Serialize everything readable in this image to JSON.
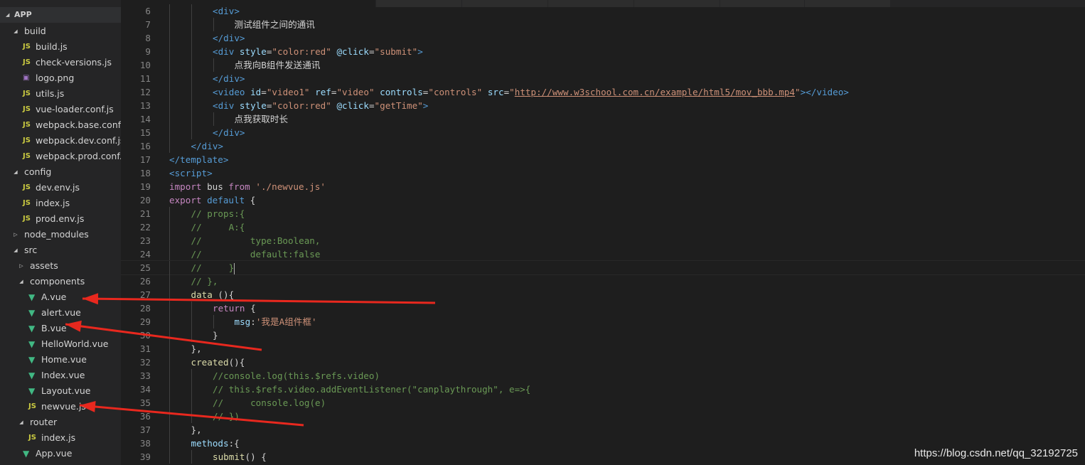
{
  "explorer": {
    "title": "APP",
    "items": [
      {
        "label": "build",
        "type": "folder",
        "expanded": true,
        "depth": 0,
        "icon": "chevron-down-icon"
      },
      {
        "label": "build.js",
        "type": "js",
        "depth": 1,
        "icon": "js-file-icon"
      },
      {
        "label": "check-versions.js",
        "type": "js",
        "depth": 1,
        "icon": "js-file-icon"
      },
      {
        "label": "logo.png",
        "type": "png",
        "depth": 1,
        "icon": "image-file-icon"
      },
      {
        "label": "utils.js",
        "type": "js",
        "depth": 1,
        "icon": "js-file-icon"
      },
      {
        "label": "vue-loader.conf.js",
        "type": "js",
        "depth": 1,
        "icon": "js-file-icon"
      },
      {
        "label": "webpack.base.conf.js",
        "type": "js",
        "depth": 1,
        "icon": "js-file-icon"
      },
      {
        "label": "webpack.dev.conf.js",
        "type": "js",
        "depth": 1,
        "icon": "js-file-icon"
      },
      {
        "label": "webpack.prod.conf.js",
        "type": "js",
        "depth": 1,
        "icon": "js-file-icon"
      },
      {
        "label": "config",
        "type": "folder",
        "expanded": true,
        "depth": 0,
        "icon": "chevron-down-icon"
      },
      {
        "label": "dev.env.js",
        "type": "js",
        "depth": 1,
        "icon": "js-file-icon"
      },
      {
        "label": "index.js",
        "type": "js",
        "depth": 1,
        "icon": "js-file-icon"
      },
      {
        "label": "prod.env.js",
        "type": "js",
        "depth": 1,
        "icon": "js-file-icon"
      },
      {
        "label": "node_modules",
        "type": "folder",
        "expanded": false,
        "depth": 0,
        "icon": "chevron-right-icon"
      },
      {
        "label": "src",
        "type": "folder",
        "expanded": true,
        "depth": 0,
        "icon": "chevron-down-icon"
      },
      {
        "label": "assets",
        "type": "folder",
        "expanded": false,
        "depth": 1,
        "icon": "chevron-right-icon"
      },
      {
        "label": "components",
        "type": "folder",
        "expanded": true,
        "depth": 1,
        "icon": "chevron-down-icon"
      },
      {
        "label": "A.vue",
        "type": "vue",
        "depth": 2,
        "icon": "vue-file-icon"
      },
      {
        "label": "alert.vue",
        "type": "vue",
        "depth": 2,
        "icon": "vue-file-icon"
      },
      {
        "label": "B.vue",
        "type": "vue",
        "depth": 2,
        "icon": "vue-file-icon"
      },
      {
        "label": "HelloWorld.vue",
        "type": "vue",
        "depth": 2,
        "icon": "vue-file-icon"
      },
      {
        "label": "Home.vue",
        "type": "vue",
        "depth": 2,
        "icon": "vue-file-icon"
      },
      {
        "label": "Index.vue",
        "type": "vue",
        "depth": 2,
        "icon": "vue-file-icon"
      },
      {
        "label": "Layout.vue",
        "type": "vue",
        "depth": 2,
        "icon": "vue-file-icon"
      },
      {
        "label": "newvue.js",
        "type": "js",
        "depth": 2,
        "icon": "js-file-icon"
      },
      {
        "label": "router",
        "type": "folder",
        "expanded": true,
        "depth": 1,
        "icon": "chevron-down-icon"
      },
      {
        "label": "index.js",
        "type": "js",
        "depth": 2,
        "icon": "js-file-icon"
      },
      {
        "label": "App.vue",
        "type": "vue",
        "depth": 1,
        "icon": "vue-file-icon"
      }
    ],
    "file_icon_text": {
      "js": "JS",
      "vue": "▼",
      "png": "▣"
    }
  },
  "editor": {
    "current_line": 25,
    "lines": [
      {
        "n": "6",
        "indent": 2,
        "tokens": [
          [
            "t-tag",
            "<div>"
          ]
        ]
      },
      {
        "n": "7",
        "indent": 3,
        "tokens": [
          [
            "t-txt",
            "测试组件之间的通讯"
          ]
        ]
      },
      {
        "n": "8",
        "indent": 2,
        "tokens": [
          [
            "t-tag",
            "</div>"
          ]
        ]
      },
      {
        "n": "9",
        "indent": 2,
        "tokens": [
          [
            "t-tag",
            "<div "
          ],
          [
            "t-attr",
            "style"
          ],
          [
            "t-txt",
            "="
          ],
          [
            "t-str",
            "\"color:red\""
          ],
          [
            "t-txt",
            " "
          ],
          [
            "t-attr",
            "@click"
          ],
          [
            "t-txt",
            "="
          ],
          [
            "t-str",
            "\"submit\""
          ],
          [
            "t-tag",
            ">"
          ]
        ]
      },
      {
        "n": "10",
        "indent": 3,
        "tokens": [
          [
            "t-txt",
            "点我向B组件发送通讯"
          ]
        ]
      },
      {
        "n": "11",
        "indent": 2,
        "tokens": [
          [
            "t-tag",
            "</div>"
          ]
        ]
      },
      {
        "n": "12",
        "indent": 2,
        "tokens": [
          [
            "t-tag",
            "<video "
          ],
          [
            "t-attr",
            "id"
          ],
          [
            "t-txt",
            "="
          ],
          [
            "t-str",
            "\"video1\""
          ],
          [
            "t-txt",
            " "
          ],
          [
            "t-attr",
            "ref"
          ],
          [
            "t-txt",
            "="
          ],
          [
            "t-str",
            "\"video\""
          ],
          [
            "t-txt",
            " "
          ],
          [
            "t-attr",
            "controls"
          ],
          [
            "t-txt",
            "="
          ],
          [
            "t-str",
            "\"controls\""
          ],
          [
            "t-txt",
            " "
          ],
          [
            "t-attr",
            "src"
          ],
          [
            "t-txt",
            "="
          ],
          [
            "t-str",
            "\""
          ],
          [
            "t-url",
            "http://www.w3school.com.cn/example/html5/mov_bbb.mp4"
          ],
          [
            "t-str",
            "\""
          ],
          [
            "t-tag",
            "></video>"
          ]
        ]
      },
      {
        "n": "13",
        "indent": 2,
        "tokens": [
          [
            "t-tag",
            "<div "
          ],
          [
            "t-attr",
            "style"
          ],
          [
            "t-txt",
            "="
          ],
          [
            "t-str",
            "\"color:red\""
          ],
          [
            "t-txt",
            " "
          ],
          [
            "t-attr",
            "@click"
          ],
          [
            "t-txt",
            "="
          ],
          [
            "t-str",
            "\"getTime\""
          ],
          [
            "t-tag",
            ">"
          ]
        ]
      },
      {
        "n": "14",
        "indent": 3,
        "tokens": [
          [
            "t-txt",
            "点我获取时长"
          ]
        ]
      },
      {
        "n": "15",
        "indent": 2,
        "tokens": [
          [
            "t-tag",
            "</div>"
          ]
        ]
      },
      {
        "n": "16",
        "indent": 1,
        "tokens": [
          [
            "t-tag",
            "</div>"
          ]
        ]
      },
      {
        "n": "17",
        "indent": 0,
        "tokens": [
          [
            "t-tag",
            "</template>"
          ]
        ]
      },
      {
        "n": "18",
        "indent": 0,
        "tokens": [
          [
            "t-tag",
            "<script>"
          ]
        ]
      },
      {
        "n": "19",
        "indent": 0,
        "tokens": [
          [
            "t-kw2",
            "import"
          ],
          [
            "t-txt",
            " bus "
          ],
          [
            "t-kw2",
            "from"
          ],
          [
            "t-txt",
            " "
          ],
          [
            "t-str",
            "'./newvue.js'"
          ]
        ]
      },
      {
        "n": "20",
        "indent": 0,
        "tokens": [
          [
            "t-kw2",
            "export"
          ],
          [
            "t-txt",
            " "
          ],
          [
            "t-kw",
            "default"
          ],
          [
            "t-txt",
            " {"
          ]
        ]
      },
      {
        "n": "21",
        "indent": 1,
        "tokens": [
          [
            "t-cm",
            "// props:{"
          ]
        ]
      },
      {
        "n": "22",
        "indent": 1,
        "tokens": [
          [
            "t-cm",
            "//     A:{"
          ]
        ]
      },
      {
        "n": "23",
        "indent": 1,
        "tokens": [
          [
            "t-cm",
            "//         type:Boolean,"
          ]
        ]
      },
      {
        "n": "24",
        "indent": 1,
        "tokens": [
          [
            "t-cm",
            "//         default:false"
          ]
        ]
      },
      {
        "n": "25",
        "indent": 1,
        "tokens": [
          [
            "t-cm",
            "//     }"
          ]
        ],
        "cursor": true
      },
      {
        "n": "26",
        "indent": 1,
        "tokens": [
          [
            "t-cm",
            "// },"
          ]
        ]
      },
      {
        "n": "27",
        "indent": 1,
        "tokens": [
          [
            "t-fn",
            "data"
          ],
          [
            "t-txt",
            " (){"
          ]
        ]
      },
      {
        "n": "28",
        "indent": 2,
        "tokens": [
          [
            "t-kw2",
            "return"
          ],
          [
            "t-txt",
            " {"
          ]
        ]
      },
      {
        "n": "29",
        "indent": 3,
        "tokens": [
          [
            "t-attr",
            "msg"
          ],
          [
            "t-txt",
            ":"
          ],
          [
            "t-str",
            "'我是A组件框'"
          ]
        ]
      },
      {
        "n": "30",
        "indent": 2,
        "tokens": [
          [
            "t-txt",
            "}"
          ]
        ]
      },
      {
        "n": "31",
        "indent": 1,
        "tokens": [
          [
            "t-txt",
            "},"
          ]
        ]
      },
      {
        "n": "32",
        "indent": 1,
        "tokens": [
          [
            "t-fn",
            "created"
          ],
          [
            "t-txt",
            "(){"
          ]
        ]
      },
      {
        "n": "33",
        "indent": 2,
        "tokens": [
          [
            "t-cm",
            "//console.log(this.$refs.video)"
          ]
        ]
      },
      {
        "n": "34",
        "indent": 2,
        "tokens": [
          [
            "t-cm",
            "// this.$refs.video.addEventListener(\"canplaythrough\", e=>{"
          ]
        ]
      },
      {
        "n": "35",
        "indent": 2,
        "tokens": [
          [
            "t-cm",
            "//     console.log(e)"
          ]
        ]
      },
      {
        "n": "36",
        "indent": 2,
        "tokens": [
          [
            "t-cm",
            "// })"
          ]
        ]
      },
      {
        "n": "37",
        "indent": 1,
        "tokens": [
          [
            "t-txt",
            "},"
          ]
        ]
      },
      {
        "n": "38",
        "indent": 1,
        "tokens": [
          [
            "t-attr",
            "methods"
          ],
          [
            "t-txt",
            ":{"
          ]
        ]
      },
      {
        "n": "39",
        "indent": 2,
        "tokens": [
          [
            "t-fn",
            "submit"
          ],
          [
            "t-txt",
            "() {"
          ]
        ]
      }
    ]
  },
  "annotations": {
    "arrow_color": "#e8281e",
    "targets": [
      "A.vue",
      "B.vue",
      "newvue.js"
    ]
  },
  "watermark": "https://blog.csdn.net/qq_32192725"
}
